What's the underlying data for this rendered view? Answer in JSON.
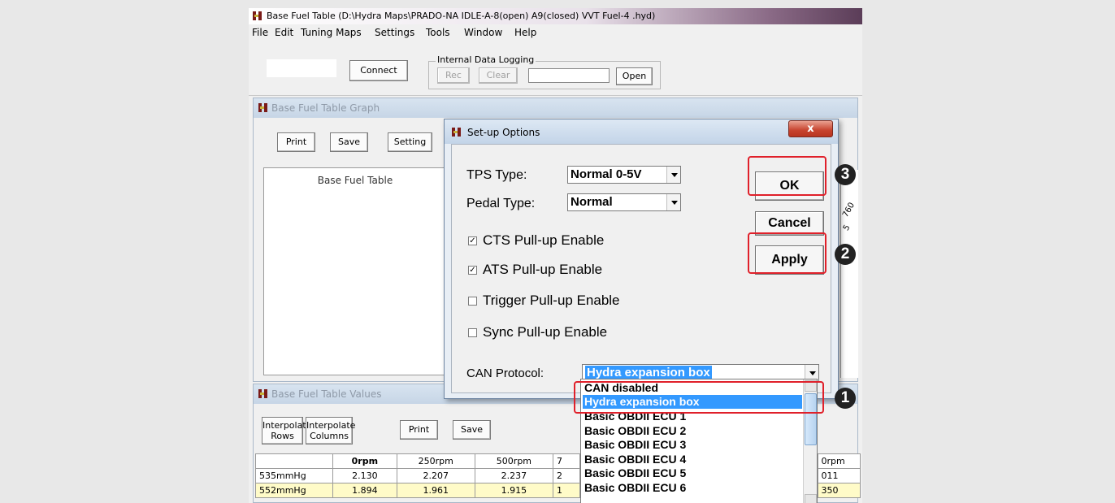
{
  "window": {
    "title": "Base Fuel Table  (D:\\Hydra Maps\\PRADO-NA IDLE-A-8(open) A9(closed) VVT Fuel-4  .hyd)"
  },
  "menu": [
    "File",
    "Edit",
    "Tuning Maps",
    "Settings",
    "Tools",
    "Window",
    "Help"
  ],
  "toolbar": {
    "connect_label": "Connect",
    "logging_group": "Internal Data Logging",
    "rec_label": "Rec",
    "clear_label": "Clear",
    "open_label": "Open"
  },
  "graph_window": {
    "title": "Base Fuel Table Graph",
    "print_label": "Print",
    "save_label": "Save",
    "setting_label": "Setting",
    "graph_title": "Base Fuel Table",
    "axis_fragment_1": "760",
    "axis_fragment_2": "5"
  },
  "values_window": {
    "title": "Base Fuel Table Values",
    "interp_rows_1": "Interpolate",
    "interp_rows_2": "Rows",
    "interp_cols_1": "Interpolate",
    "interp_cols_2": "Columns",
    "print_label": "Print",
    "save_label": "Save",
    "headers": [
      "",
      "0rpm",
      "250rpm",
      "500rpm",
      "7",
      "0rpm"
    ],
    "rows": [
      {
        "label": "535mmHg",
        "v0": "2.130",
        "v1": "2.207",
        "v2": "2.237",
        "v3": "2",
        "v4": "011"
      },
      {
        "label": "552mmHg",
        "v0": "1.894",
        "v1": "1.961",
        "v2": "1.915",
        "v3": "1",
        "v4": "350"
      }
    ]
  },
  "dialog": {
    "title": "Set-up Options",
    "close_glyph": "x",
    "tps_label": "TPS Type:",
    "tps_value": "Normal 0-5V",
    "pedal_label": "Pedal Type:",
    "pedal_value": "Normal",
    "checkboxes": [
      {
        "label": "CTS Pull-up Enable",
        "checked": true,
        "mark": "✓"
      },
      {
        "label": "ATS Pull-up Enable",
        "checked": true,
        "mark": "✓"
      },
      {
        "label": "Trigger Pull-up Enable",
        "checked": false,
        "mark": ""
      },
      {
        "label": "Sync Pull-up Enable",
        "checked": false,
        "mark": ""
      }
    ],
    "can_label": "CAN Protocol:",
    "can_value": "Hydra expansion box",
    "ok_label": "OK",
    "cancel_label": "Cancel",
    "apply_label": "Apply"
  },
  "dropdown": {
    "options": [
      "CAN disabled",
      "Hydra expansion box",
      "Basic OBDII ECU 1",
      "Basic OBDII ECU 2",
      "Basic OBDII ECU 3",
      "Basic OBDII ECU 4",
      "Basic OBDII ECU 5",
      "Basic OBDII ECU 6"
    ],
    "selected_index": 1
  },
  "badges": {
    "one": "1",
    "two": "2",
    "three": "3"
  },
  "colors": {
    "highlight": "#3399ff",
    "callout": "#e0202a",
    "row_highlight": "#fffbc8"
  }
}
